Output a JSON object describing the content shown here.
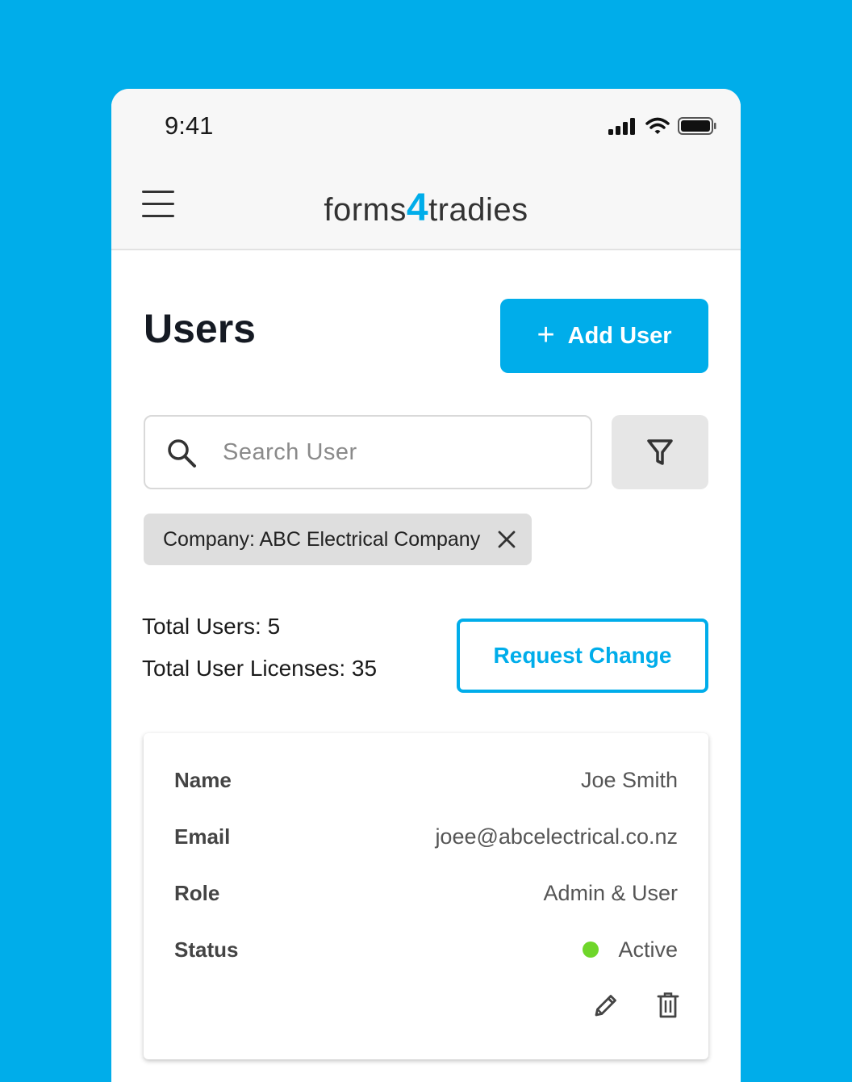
{
  "status_bar": {
    "time": "9:41"
  },
  "header": {
    "logo_left": "forms",
    "logo_mid": "4",
    "logo_right": "tradies"
  },
  "page": {
    "title": "Users",
    "add_user_label": "Add User"
  },
  "search": {
    "placeholder": "Search User",
    "value": ""
  },
  "filter_chip": {
    "label": "Company: ABC Electrical Company"
  },
  "totals": {
    "users": "Total Users: 5",
    "licenses": "Total User Licenses: 35"
  },
  "request_change_label": "Request Change",
  "user": {
    "name_label": "Name",
    "name": "Joe Smith",
    "email_label": "Email",
    "email": "joee@abcelectrical.co.nz",
    "role_label": "Role",
    "role": "Admin & User",
    "status_label": "Status",
    "status": "Active",
    "status_color": "#6fd62a"
  },
  "colors": {
    "accent": "#00ADEA",
    "background": "#00ADEA"
  }
}
